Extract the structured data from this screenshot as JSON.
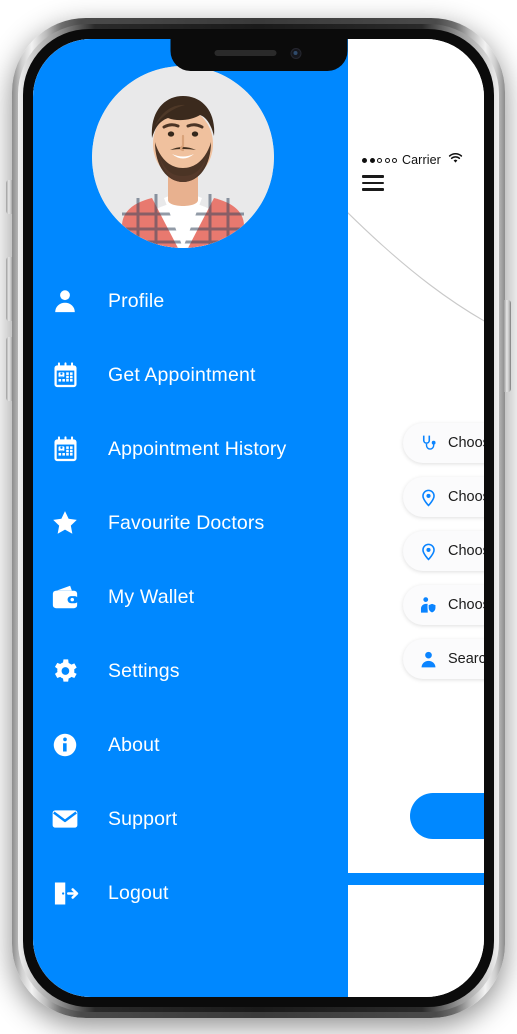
{
  "device": {
    "type": "smartphone-mockup",
    "notch": {
      "speaker": "speaker-grille",
      "camera": "front-camera"
    },
    "buttons": [
      "silent-switch",
      "volume-up",
      "volume-down",
      "power"
    ]
  },
  "theme": {
    "accent": "#0088FF",
    "drawer_background": "#0088FF",
    "screen_background": "#FFFFFF",
    "menu_label_color": "#FFFFFF",
    "card_background": "#FBFBFC",
    "card_text_color": "#1B1B1B"
  },
  "status_bar": {
    "signal_label": "●●○○○",
    "signal_filled": 2,
    "signal_total": 5,
    "carrier": "Carrier",
    "wifi_icon": "wifi-icon"
  },
  "app_screen": {
    "menu_toggle_icon": "hamburger-menu-icon",
    "decoration": "curved-line-decoration",
    "cards": [
      {
        "icon": "stethoscope-icon",
        "label": "Choose"
      },
      {
        "icon": "location-pin-icon",
        "label": "Choose"
      },
      {
        "icon": "location-pin-icon",
        "label": "Choose"
      },
      {
        "icon": "doctor-shield-icon",
        "label": "Choose"
      },
      {
        "icon": "doctor-avatar-icon",
        "label": "Search"
      }
    ],
    "primary_button_label": ""
  },
  "drawer": {
    "avatar": {
      "name": "user-avatar",
      "alt": "profile photo of bearded man in plaid shirt"
    },
    "items": [
      {
        "icon": "user-icon",
        "label": "Profile"
      },
      {
        "icon": "calendar-icon",
        "label": "Get Appointment"
      },
      {
        "icon": "calendar-history-icon",
        "label": "Appointment History"
      },
      {
        "icon": "star-icon",
        "label": "Favourite Doctors"
      },
      {
        "icon": "wallet-icon",
        "label": "My Wallet"
      },
      {
        "icon": "gear-icon",
        "label": "Settings"
      },
      {
        "icon": "info-circle-icon",
        "label": "About"
      },
      {
        "icon": "envelope-icon",
        "label": "Support"
      },
      {
        "icon": "logout-icon",
        "label": "Logout"
      }
    ]
  }
}
